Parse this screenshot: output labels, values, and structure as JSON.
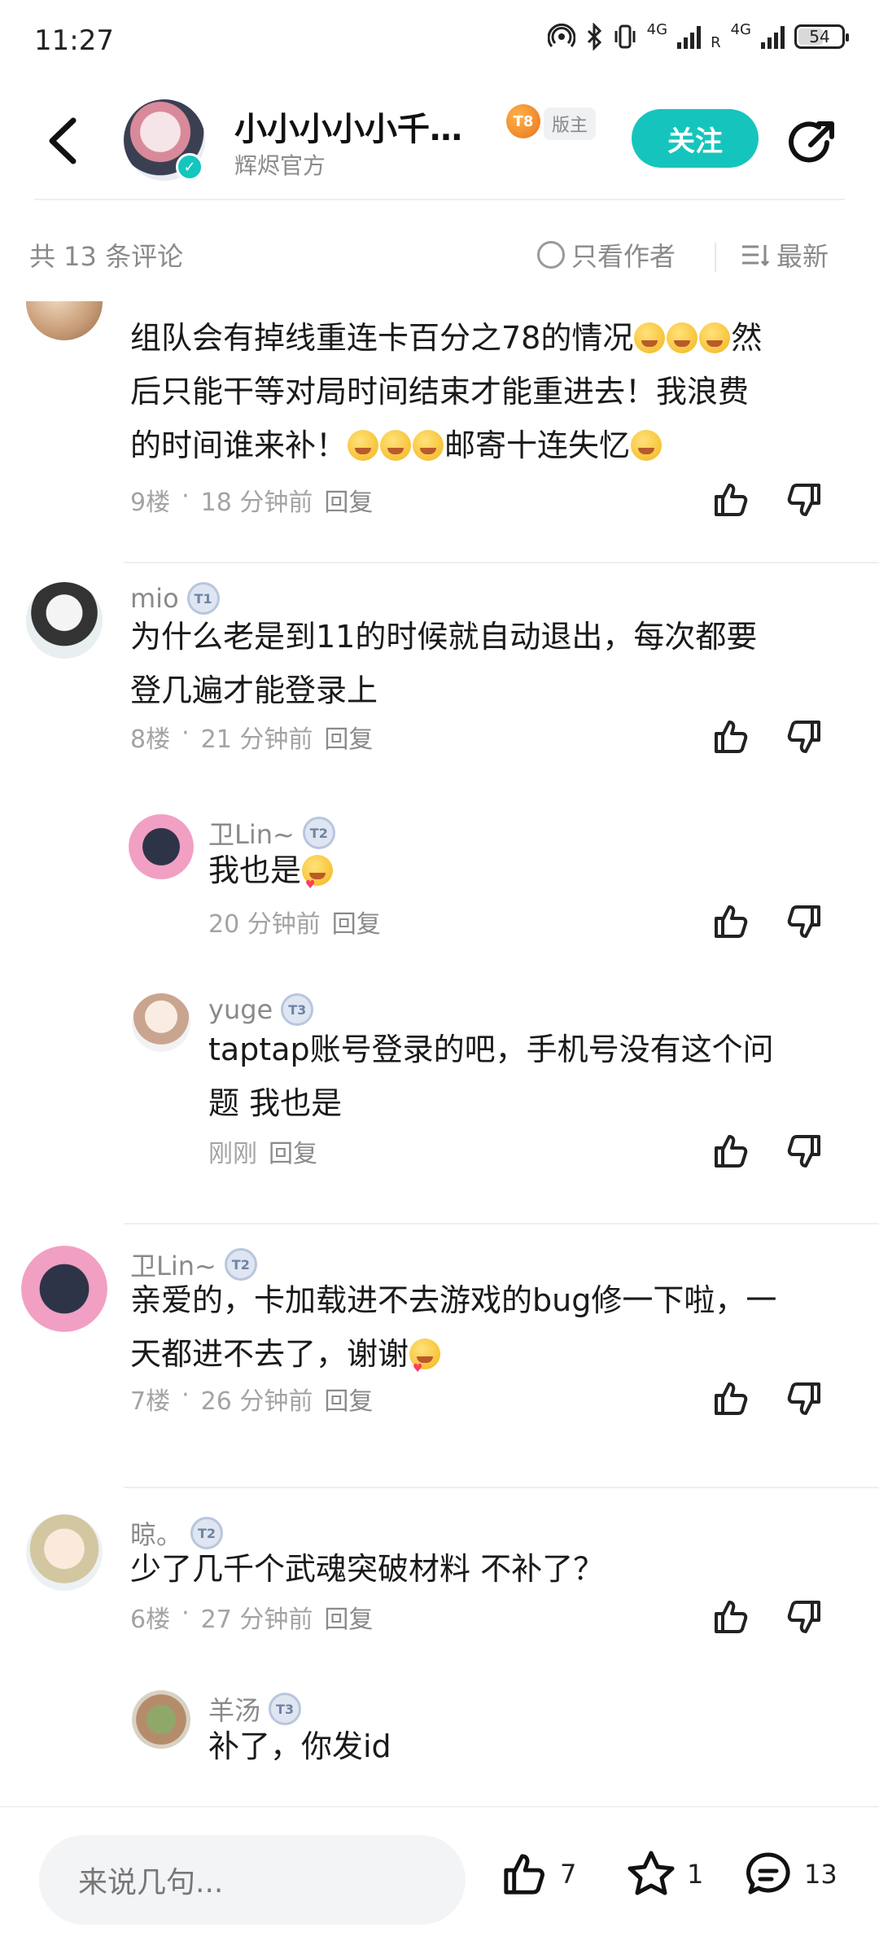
{
  "status_bar": {
    "time": "11:27",
    "network_1": "4G",
    "network_2": "4G",
    "roaming": "R",
    "battery": "54"
  },
  "header": {
    "author_name": "小小小小小千…",
    "author_sub": "辉烬官方",
    "level_badge": "8",
    "role_tag": "版主",
    "follow_label": "关注"
  },
  "filter": {
    "count_text": "共 13 条评论",
    "author_only_label": "只看作者",
    "sort_label": "最新"
  },
  "comments": [
    {
      "username": "",
      "level": "",
      "body_lines": [
        "组队会有掉线重连卡百分之78的情况",
        "然",
        "后只能干等对局时间结束才能重进去！我浪费",
        "的时间谁来补！",
        "邮寄十连失忆"
      ],
      "floor": "9楼",
      "time": "18 分钟前",
      "reply": "回复"
    },
    {
      "username": "mio",
      "level": "1",
      "body_lines": [
        "为什么老是到11的时候就自动退出，每次都要",
        "登几遍才能登录上"
      ],
      "floor": "8楼",
      "time": "21 分钟前",
      "reply": "回复"
    },
    {
      "username": "卫Lin~",
      "level": "2",
      "body_lines": [
        "我也是"
      ],
      "floor": "",
      "time": "20 分钟前",
      "reply": "回复"
    },
    {
      "username": "yuge",
      "level": "3",
      "body_lines": [
        "taptap账号登录的吧，手机号没有这个问",
        "题 我也是"
      ],
      "floor": "",
      "time": "刚刚",
      "reply": "回复"
    },
    {
      "username": "卫Lin~",
      "level": "2",
      "body_lines": [
        "亲爱的，卡加载进不去游戏的bug修一下啦，一",
        "天都进不去了，谢谢"
      ],
      "floor": "7楼",
      "time": "26 分钟前",
      "reply": "回复"
    },
    {
      "username": "晾。",
      "level": "2",
      "body_lines": [
        "少了几千个武魂突破材料  不补了？"
      ],
      "floor": "6楼",
      "time": "27 分钟前",
      "reply": "回复"
    },
    {
      "username": "羊汤",
      "level": "3",
      "body_lines": [
        "补了，你发id"
      ],
      "floor": "",
      "time": "",
      "reply": ""
    }
  ],
  "bottom_bar": {
    "input_placeholder": "来说几句...",
    "like_count": "7",
    "favorite_count": "1",
    "comment_count": "13"
  },
  "colors": {
    "accent": "#15c5bd",
    "meta_text": "#a3a3a3",
    "divider": "#efefef"
  }
}
